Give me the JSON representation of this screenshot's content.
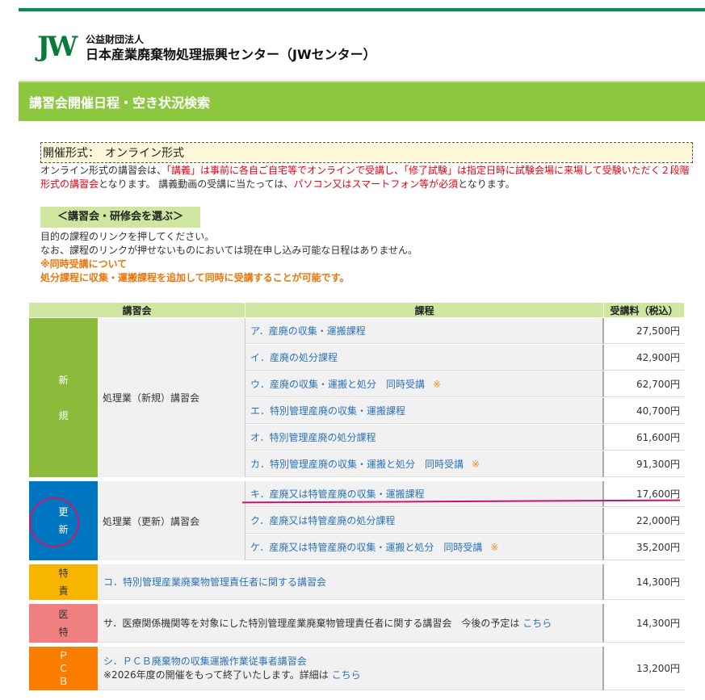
{
  "org": {
    "logo": "JW",
    "sub": "公益財団法人",
    "name": "日本産業廃棄物処理振興センター（JWセンター）"
  },
  "title": "講習会開催日程・空き状況検索",
  "format": {
    "label": "開催形式：",
    "value": "オンライン形式"
  },
  "description": {
    "p1": "オンライン形式の講習会は、",
    "r1": "「講義」は事前に各自ご自宅等でオンラインで受講し、「修了試験」は指定日時に試験会場に来場して受験いただく２段階形式の講習会",
    "p2": "となります。 講義動画の受講に当たっては、",
    "r2": "パソコン又はスマートフォン等が必須",
    "p3": "となります。"
  },
  "choose_label": "＜講習会・研修会を選ぶ＞",
  "notes": {
    "line1": "目的の課程のリンクを押してください。",
    "line2": "なお、課程のリンクが押せないものにおいては現在申し込み可能な日程はありません。",
    "line3": "※同時受講について",
    "line4": "処分課程に収集・運搬課程を追加して同時に受講することが可能です。"
  },
  "table": {
    "headers": {
      "session": "講習会",
      "course": "課程",
      "fee": "受講料（税込）"
    },
    "groups": {
      "new": {
        "cat1": "新",
        "cat2": "規",
        "session": "処理業（新規）講習会",
        "rows": [
          {
            "course": "ア．産廃の収集・運搬課程",
            "fee": "27,500円"
          },
          {
            "course": "イ．産廃の処分課程",
            "fee": "42,900円"
          },
          {
            "course": "ウ．産廃の収集・運搬と処分　同時受講",
            "mark": "※",
            "fee": "62,700円"
          },
          {
            "course": "エ．特別管理産廃の収集・運搬課程",
            "fee": "40,700円"
          },
          {
            "course": "オ．特別管理産廃の処分課程",
            "fee": "61,600円"
          },
          {
            "course": "カ．特別管理産廃の収集・運搬と処分　同時受講",
            "mark": "※",
            "fee": "91,300円"
          }
        ]
      },
      "renew": {
        "cat1": "更",
        "cat2": "新",
        "session": "処理業（更新）講習会",
        "rows": [
          {
            "course": "キ．産廃又は特管産廃の収集・運搬課程",
            "fee": "17,600円"
          },
          {
            "course": "ク．産廃又は特管産廃の処分課程",
            "fee": "22,000円"
          },
          {
            "course": "ケ．産廃又は特管産廃の収集・運搬と処分　同時受講",
            "mark": "※",
            "fee": "35,200円"
          }
        ]
      },
      "toku": {
        "cat1": "特",
        "cat2": "責",
        "course": "コ．特別管理産業廃棄物管理責任者に関する講習会",
        "fee": "14,300円"
      },
      "iryo": {
        "cat1": "医",
        "cat2": "特",
        "course": "サ．医療関係機関等を対象にした特別管理産業廃棄物管理責任者に関する講習会　今後の予定は",
        "link": "こちら",
        "fee": "14,300円"
      },
      "pcb": {
        "cat1": "Ｐ",
        "cat2": "Ｃ",
        "cat3": "Ｂ",
        "course": "シ．ＰＣＢ廃棄物の収集運搬作業従事者講習会",
        "note": "※2026年度の開催をもって終了いたします。詳細は",
        "link": "こちら",
        "fee": "13,200円"
      }
    }
  },
  "colors": {
    "brand_green": "#0a8a5a",
    "title_bar": "#8dc63f",
    "header_bg": "#cfe6a0",
    "new": "#8cba3a",
    "renew": "#0076c0",
    "toku": "#f8b500",
    "iryo": "#f08080",
    "pcb": "#fa7d00",
    "annotation": "#c8146e"
  }
}
